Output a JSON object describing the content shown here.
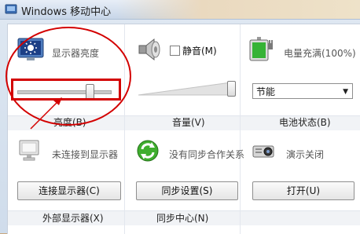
{
  "window": {
    "title": "Windows 移动中心"
  },
  "tiles": {
    "brightness": {
      "label": "显示器亮度",
      "footer": "亮度(B)",
      "level": 0.78
    },
    "volume": {
      "mute_label": "静音(M)",
      "footer": "音量(V)",
      "level": 1.0
    },
    "battery": {
      "label": "电量充满(100%)",
      "plan_value": "节能",
      "footer": "电池状态(B)",
      "charge_percent": 100
    },
    "display": {
      "label": "未连接到显示器",
      "button": "连接显示器(C)",
      "footer": "外部显示器(X)"
    },
    "sync": {
      "label": "没有同步合作关系",
      "button": "同步设置(S)",
      "footer": "同步中心(N)"
    },
    "presentation": {
      "label": "演示关闭",
      "button": "打开(U)"
    }
  },
  "colors": {
    "annotation_red": "#d30000",
    "battery_green": "#36b336"
  },
  "icons": [
    "mobility-center-icon",
    "brightness-display-icon",
    "speaker-icon",
    "battery-plug-icon",
    "monitor-icon",
    "sync-icon",
    "projector-icon"
  ]
}
